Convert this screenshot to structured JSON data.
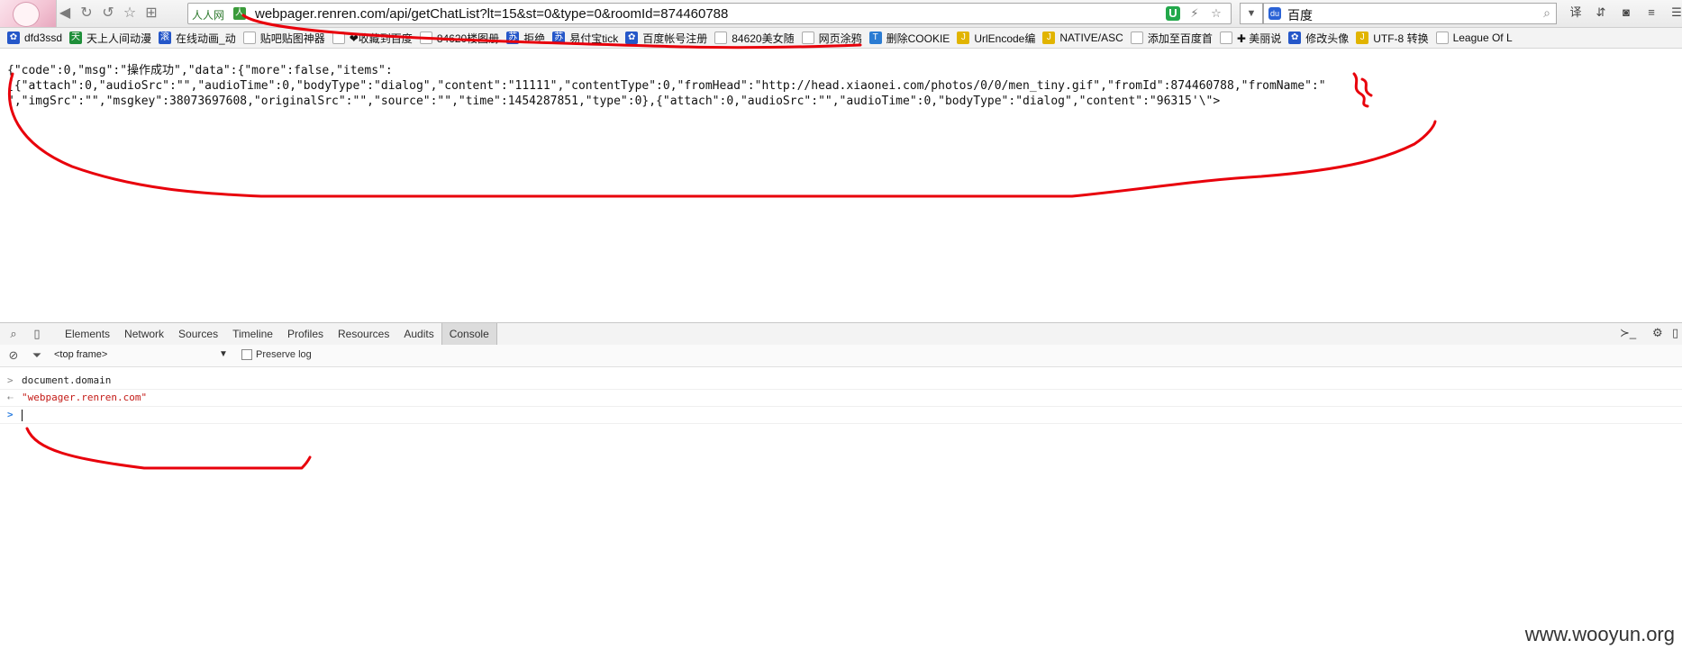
{
  "toolbar": {
    "site_tag": "人人网",
    "url": "webpager.renren.com/api/getChatList?lt=15&st=0&type=0&roomId=874460788",
    "search_text": "百度",
    "icons": [
      "back-icon",
      "refresh-icon",
      "undo-icon",
      "star-icon",
      "apps-icon",
      "shield-icon",
      "lightning-icon",
      "bookmark-star-icon",
      "dropdown-icon",
      "search-icon"
    ]
  },
  "bookmarks": [
    {
      "label": "dfd3ssd",
      "icon": "paw-icon"
    },
    {
      "label": "天上人间动漫",
      "icon": "tian-icon"
    },
    {
      "label": "在线动画_动",
      "icon": "page-icon"
    },
    {
      "label": "贴吧贴图神器",
      "icon": "page-icon"
    },
    {
      "label": "❤收藏到百度",
      "icon": "page-icon"
    },
    {
      "label": "84620楼图册",
      "icon": "page-icon"
    },
    {
      "label": "拒绝",
      "icon": "su-icon"
    },
    {
      "label": "易付宝tick",
      "icon": "su-icon"
    },
    {
      "label": "百度帐号注册",
      "icon": "paw-icon"
    },
    {
      "label": "84620美女随",
      "icon": "page-icon"
    },
    {
      "label": "网页涂鸦",
      "icon": "page-icon"
    },
    {
      "label": "删除COOKIE",
      "icon": "shield-icon"
    },
    {
      "label": "UrlEncode编",
      "icon": "page-icon"
    },
    {
      "label": "NATIVE/ASC",
      "icon": "page-icon"
    },
    {
      "label": "添加至百度首",
      "icon": "page-icon"
    },
    {
      "label": "✚ 美丽说",
      "icon": "page-icon"
    },
    {
      "label": "修改头像",
      "icon": "paw-icon"
    },
    {
      "label": "UTF-8 转换",
      "icon": "page-icon"
    },
    {
      "label": "League Of L",
      "icon": "page-icon"
    }
  ],
  "content": {
    "line1": "{\"code\":0,\"msg\":\"操作成功\",\"data\":{\"more\":false,\"items\":",
    "line2": "[{\"attach\":0,\"audioSrc\":\"\",\"audioTime\":0,\"bodyType\":\"dialog\",\"content\":\"11111\",\"contentType\":0,\"fromHead\":\"http://head.xiaonei.com/photos/0/0/men_tiny.gif\",\"fromId\":874460788,\"fromName\":\"",
    "line3": "\",\"imgSrc\":\"\",\"msgkey\":38073697608,\"originalSrc\":\"\",\"source\":\"\",\"time\":1454287851,\"type\":0},{\"attach\":0,\"audioSrc\":\"\",\"audioTime\":0,\"bodyType\":\"dialog\",\"content\":\"96315'\\\"> "
  },
  "devtools": {
    "tabs": [
      "Elements",
      "Network",
      "Sources",
      "Timeline",
      "Profiles",
      "Resources",
      "Audits",
      "Console"
    ],
    "active_tab": "Console",
    "frame": "<top frame>",
    "preserve_log": "Preserve log",
    "console_lines": [
      {
        "kind": "input",
        "text": "document.domain"
      },
      {
        "kind": "output",
        "text": "\"webpager.renren.com\""
      }
    ]
  },
  "watermark": "www.wooyun.org",
  "annotation_color": "#e8000b"
}
